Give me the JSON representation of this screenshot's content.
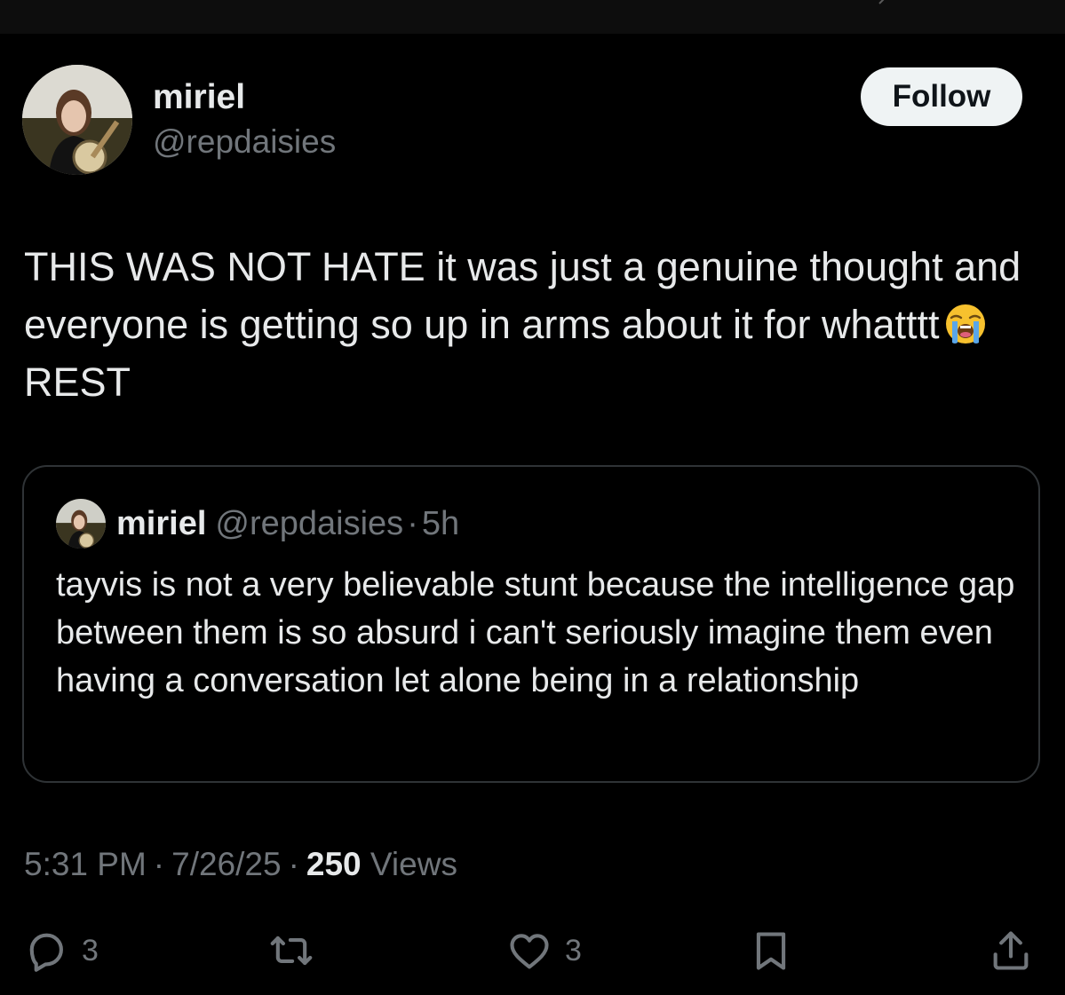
{
  "author": {
    "name": "miriel",
    "handle": "@repdaisies"
  },
  "follow_label": "Follow",
  "tweet": {
    "text_before_emoji": "THIS WAS NOT HATE it was just a genuine thought and everyone is getting so up in arms about it for whatttt",
    "emoji": "loudly-crying-face",
    "text_after_emoji": "REST"
  },
  "quote": {
    "name": "miriel",
    "handle": "@repdaisies",
    "dot": "·",
    "time": "5h",
    "text": "tayvis is not a very believable stunt because the intelligence gap between them is so absurd i can't seriously imagine them even having a conversation let alone being in a relationship"
  },
  "meta": {
    "time": "5:31 PM",
    "sep": "·",
    "date": "7/26/25",
    "views_count": "250",
    "views_label": "Views"
  },
  "actions": {
    "reply_count": "3",
    "retweet_count": "",
    "like_count": "3"
  },
  "colors": {
    "background": "#000000",
    "text_primary": "#e7e9ea",
    "text_secondary": "#71767b",
    "border": "#2f3336",
    "follow_bg": "#eff3f4"
  },
  "icons": [
    "reply-icon",
    "retweet-icon",
    "like-icon",
    "bookmark-icon",
    "share-icon"
  ]
}
